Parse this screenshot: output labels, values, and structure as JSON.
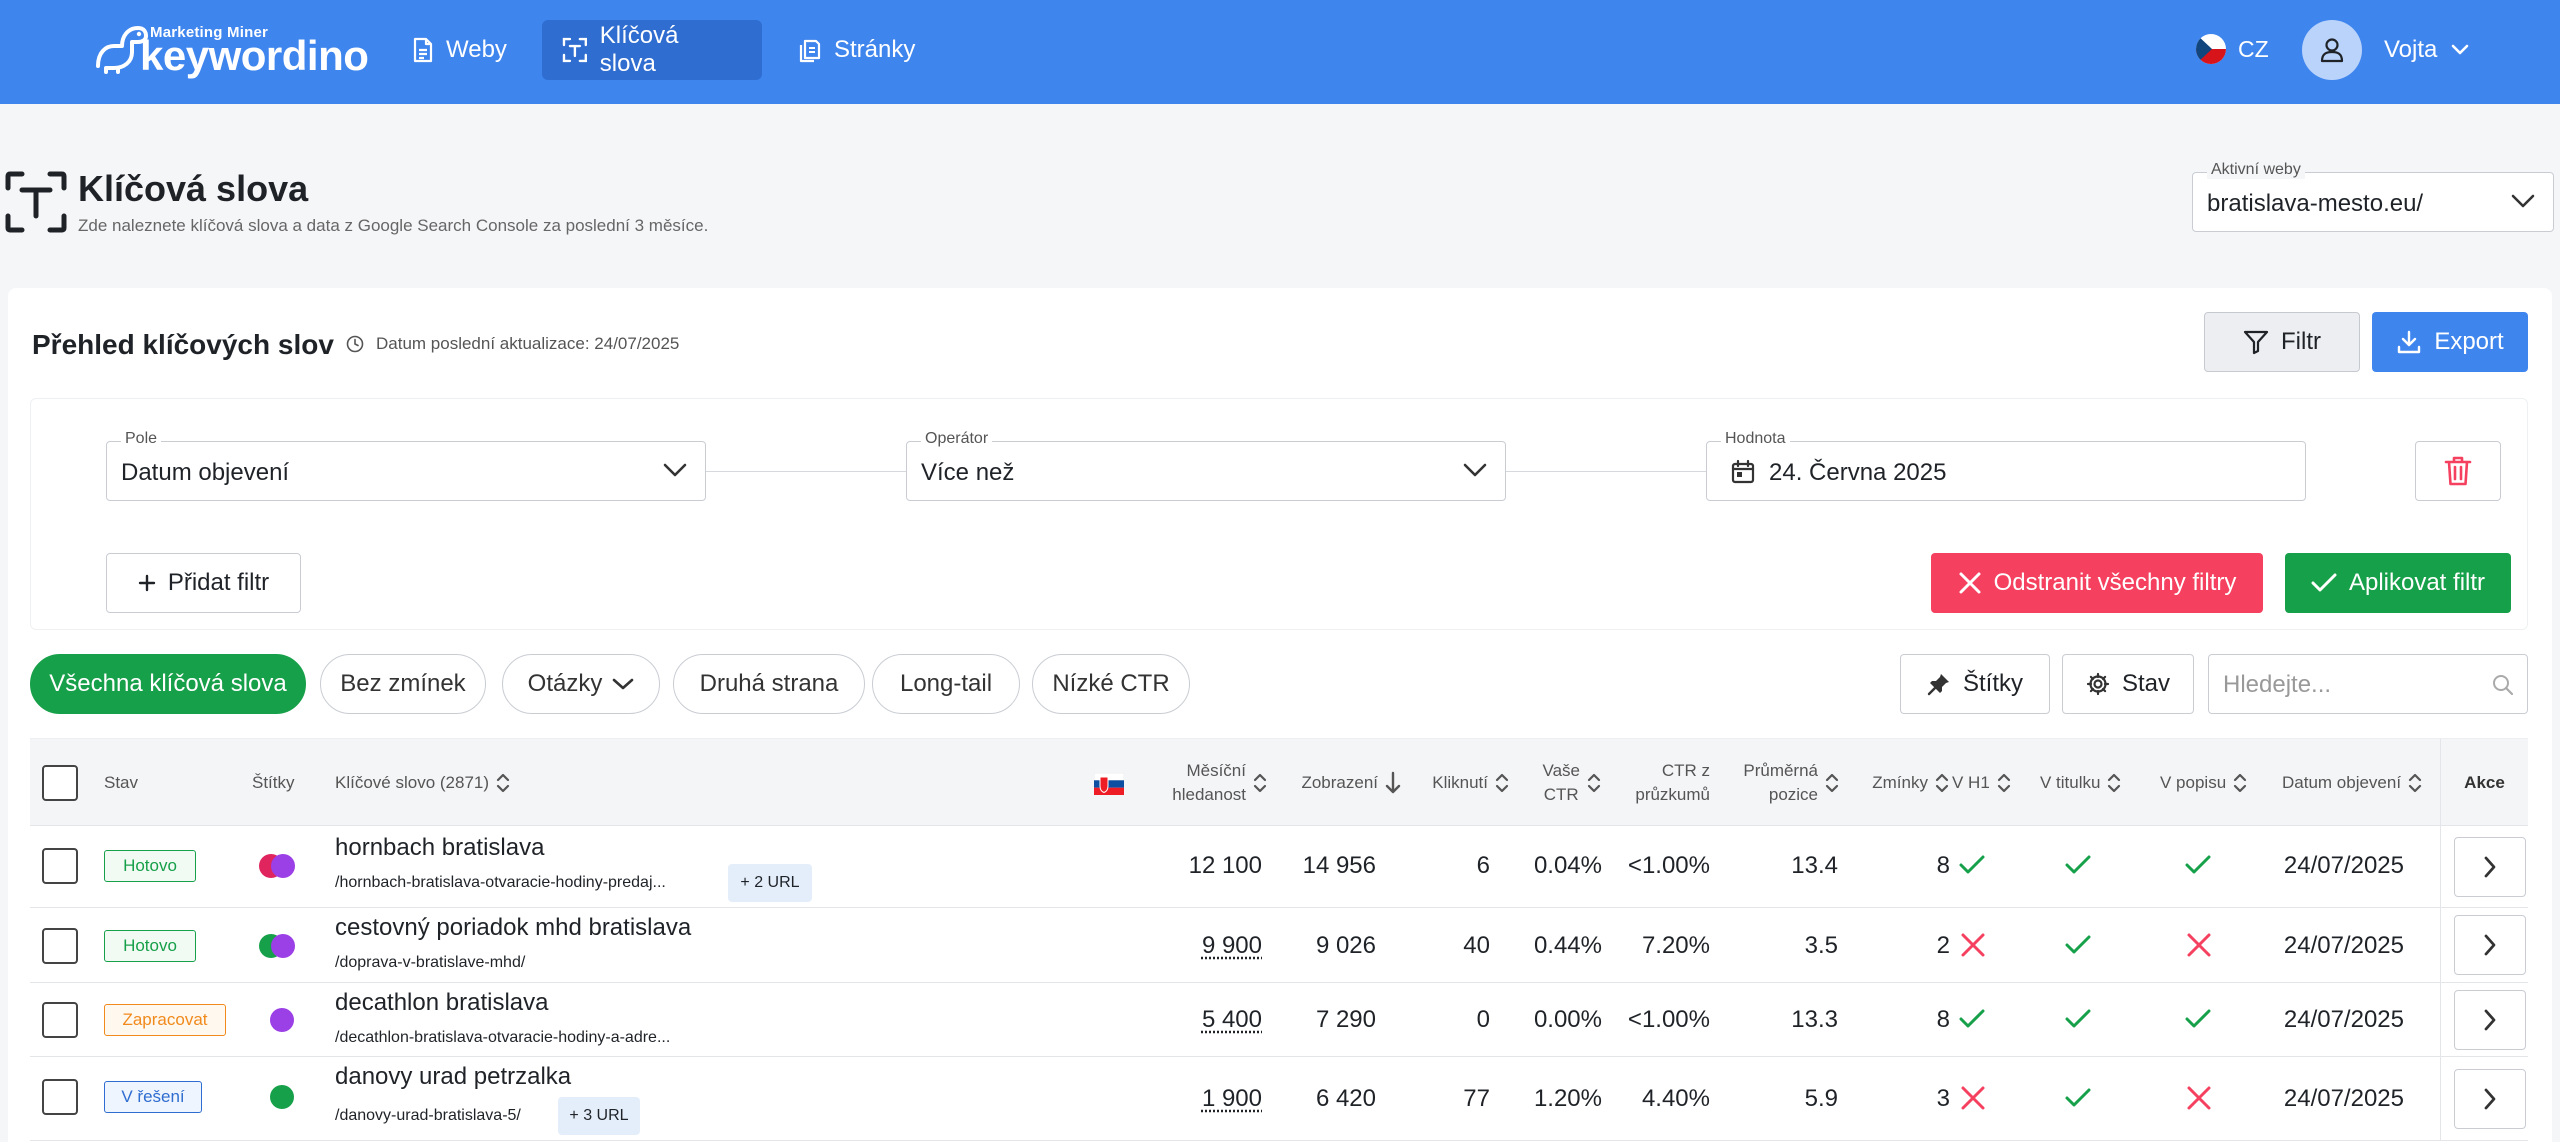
{
  "nav": {
    "logo_small": "Marketing Miner",
    "logo_big": "keywordino",
    "items": [
      {
        "label": "Weby",
        "icon": "document-icon"
      },
      {
        "label": "Klíčová slova",
        "icon": "keyword-scan-icon"
      },
      {
        "label": "Stránky",
        "icon": "pages-icon"
      }
    ],
    "lang": "CZ",
    "user": "Vojta"
  },
  "page": {
    "title": "Klíčová slova",
    "subtitle": "Zde naleznete klíčová slova a data z Google Search Console za poslední 3 měsíce.",
    "active_web_label": "Aktivní weby",
    "active_web_value": "bratislava-mesto.eu/"
  },
  "card": {
    "title": "Přehled klíčových slov",
    "updated": "Datum poslední aktualizace: 24/07/2025",
    "filter_label": "Filtr",
    "export_label": "Export"
  },
  "filter": {
    "field_label": "Pole",
    "field_value": "Datum objevení",
    "operator_label": "Operátor",
    "operator_value": "Více než",
    "value_label": "Hodnota",
    "value_value": "24. Června 2025",
    "add_label": "Přidat filtr",
    "remove_all_label": "Odstranit všechny filtry",
    "apply_label": "Aplikovat filtr"
  },
  "chips": [
    "Všechna klíčová slova",
    "Bez zmínek",
    "Otázky",
    "Druhá strana",
    "Long-tail",
    "Nízké CTR"
  ],
  "tools": {
    "tags_label": "Štítky",
    "status_label": "Stav",
    "search_placeholder": "Hledejte..."
  },
  "columns": {
    "stav": "Stav",
    "stitky": "Štítky",
    "keyword": "Klíčové slovo (2871)",
    "monthly_1": "Měsíční",
    "monthly_2": "hledanost",
    "impressions": "Zobrazení",
    "clicks": "Kliknutí",
    "ctr_1": "Vaše",
    "ctr_2": "CTR",
    "ctr_survey_1": "CTR z",
    "ctr_survey_2": "průzkumů",
    "avg_pos_1": "Průměrná",
    "avg_pos_2": "pozice",
    "mentions": "Zmínky",
    "in_h1": "V H1",
    "in_title": "V titulku",
    "in_desc": "V popisu",
    "discovered": "Datum objevení",
    "actions": "Akce"
  },
  "rows": [
    {
      "status": "Hotovo",
      "status_color": "green",
      "tags": [
        "#e0245e",
        "#9b3fe6"
      ],
      "keyword": "hornbach bratislava",
      "url": "/hornbach-bratislava-otvaracie-hodiny-predaj...",
      "extra_urls": "+ 2 URL",
      "monthly": "12 100",
      "impressions": "14 956",
      "clicks": "6",
      "ctr": "0.04%",
      "ctr_survey": "<1.00%",
      "avg_pos": "13.4",
      "mentions": "8",
      "h1": true,
      "title": true,
      "desc": true,
      "discovered": "24/07/2025"
    },
    {
      "status": "Hotovo",
      "status_color": "green",
      "tags": [
        "#17a04a",
        "#9b3fe6"
      ],
      "keyword": "cestovný poriadok mhd bratislava",
      "url": "/doprava-v-bratislave-mhd/",
      "extra_urls": "",
      "monthly": "9 900",
      "impressions": "9 026",
      "clicks": "40",
      "ctr": "0.44%",
      "ctr_survey": "7.20%",
      "avg_pos": "3.5",
      "mentions": "2",
      "h1": false,
      "title": true,
      "desc": false,
      "discovered": "24/07/2025"
    },
    {
      "status": "Zapracovat",
      "status_color": "orange",
      "tags": [
        "#9b3fe6"
      ],
      "keyword": "decathlon bratislava",
      "url": "/decathlon-bratislava-otvaracie-hodiny-a-adre...",
      "extra_urls": "",
      "monthly": "5 400",
      "impressions": "7 290",
      "clicks": "0",
      "ctr": "0.00%",
      "ctr_survey": "<1.00%",
      "avg_pos": "13.3",
      "mentions": "8",
      "h1": true,
      "title": true,
      "desc": true,
      "discovered": "24/07/2025"
    },
    {
      "status": "V řešení",
      "status_color": "blue",
      "tags": [
        "#17a04a"
      ],
      "keyword": "danovy urad petrzalka",
      "url": "/danovy-urad-bratislava-5/",
      "extra_urls": "+ 3 URL",
      "monthly": "1 900",
      "impressions": "6 420",
      "clicks": "77",
      "ctr": "1.20%",
      "ctr_survey": "4.40%",
      "avg_pos": "5.9",
      "mentions": "3",
      "h1": false,
      "title": true,
      "desc": false,
      "discovered": "24/07/2025"
    }
  ],
  "colors": {
    "primary": "#3f85ee",
    "success": "#17a04a",
    "danger": "#f5405f",
    "tag_purple": "#9b3fe6"
  }
}
